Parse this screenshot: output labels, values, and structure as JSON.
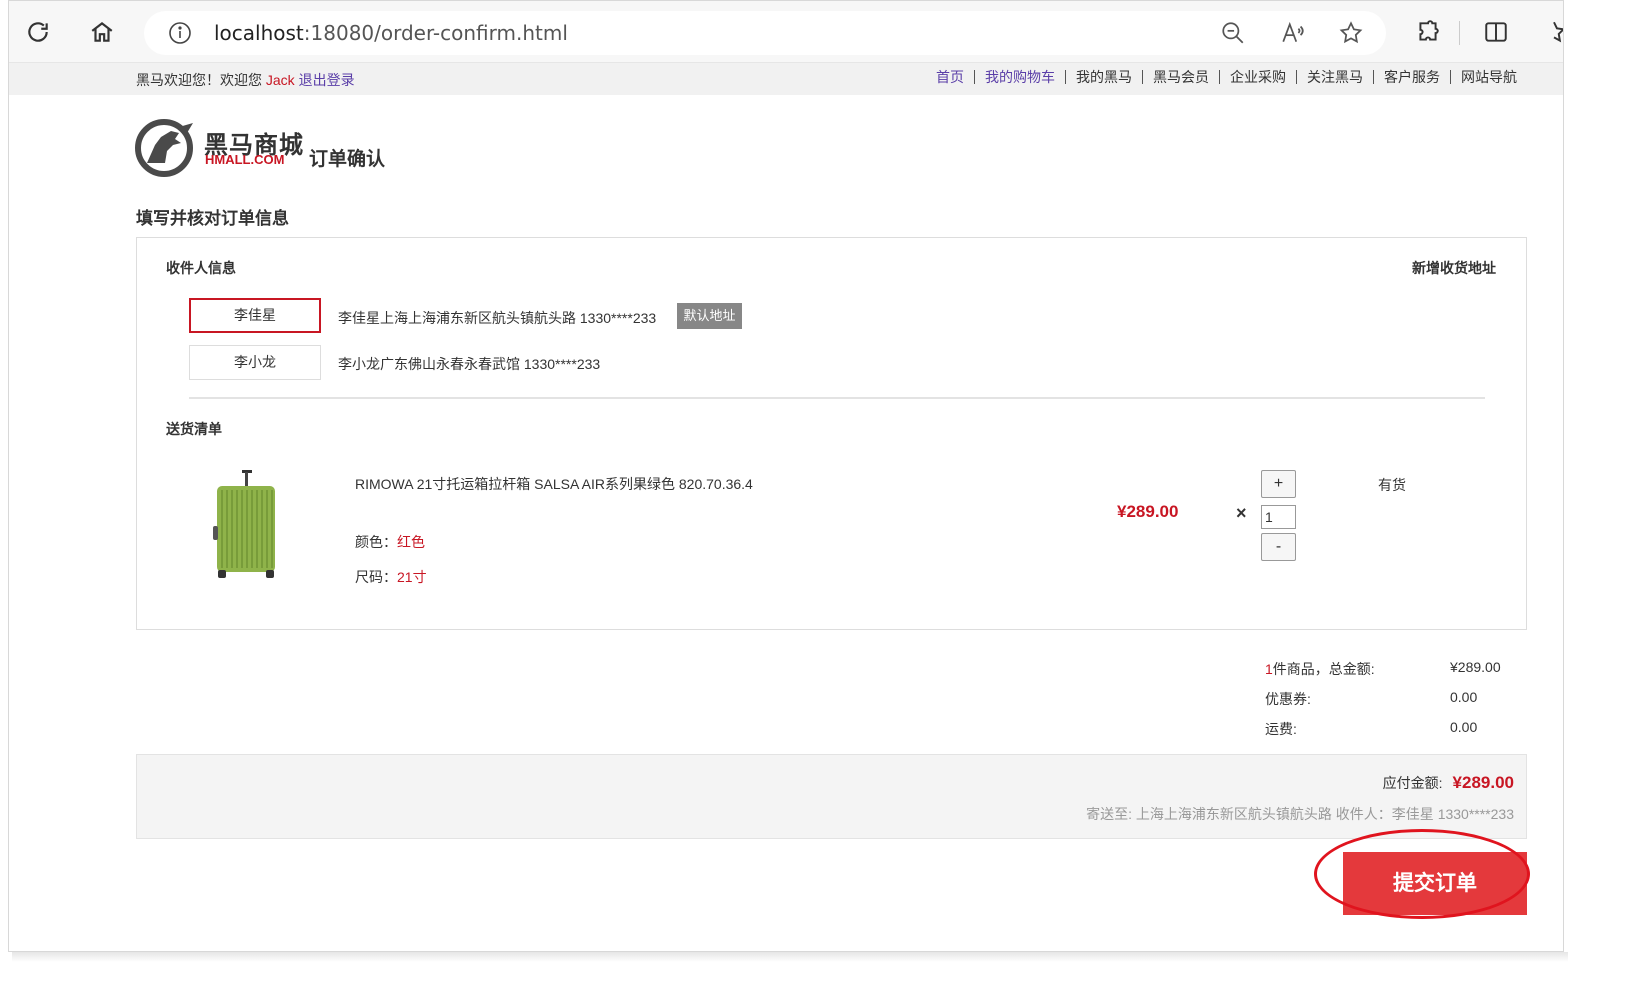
{
  "browser": {
    "url_host": "localhost",
    "url_path": ":18080/order-confirm.html"
  },
  "topbar": {
    "welcome": "黑马欢迎您！欢迎您",
    "user": "Jack",
    "logout": "退出登录",
    "nav": [
      "首页",
      "我的购物车",
      "我的黑马",
      "黑马会员",
      "企业采购",
      "关注黑马",
      "客户服务",
      "网站导航"
    ]
  },
  "logo": {
    "cn": "黑马商城",
    "en": "HMALL.COM"
  },
  "page_heading": "订单确认",
  "section_title": "填写并核对订单信息",
  "receiver": {
    "title": "收件人信息",
    "add_address": "新增收货地址",
    "addresses": [
      {
        "name": "李佳星",
        "detail": "李佳星上海上海浦东新区航头镇航头路 1330****233",
        "selected": true,
        "badge": "默认地址"
      },
      {
        "name": "李小龙",
        "detail": "李小龙广东佛山永春永春武馆 1330****233",
        "selected": false
      }
    ]
  },
  "delivery": {
    "title": "送货清单",
    "item": {
      "name": "RIMOWA 21寸托运箱拉杆箱 SALSA AIR系列果绿色 820.70.36.4",
      "color_label": "颜色：",
      "color_value": "红色",
      "size_label": "尺码：",
      "size_value": "21寸",
      "price": "¥289.00",
      "times": "×",
      "quantity": "1",
      "plus": "+",
      "minus": "-",
      "stock": "有货",
      "image_color": "#8fb34a"
    }
  },
  "summary": {
    "count": "1",
    "count_label": "件商品，总金额:",
    "total": "¥289.00",
    "coupon_label": "优惠券:",
    "coupon": "0.00",
    "shipping_label": "运费:",
    "shipping": "0.00"
  },
  "payment": {
    "label": "应付金额:",
    "amount": "¥289.00",
    "ship_to": "寄送至: 上海上海浦东新区航头镇航头路 收件人：李佳星 1330****233"
  },
  "submit": "提交订单",
  "colors": {
    "accent": "#c81623",
    "button": "#e4393c",
    "annotation": "#e0141e"
  }
}
